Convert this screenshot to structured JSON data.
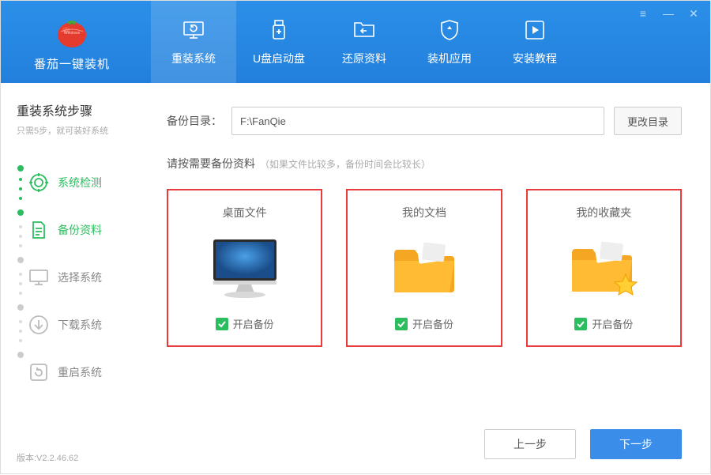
{
  "app": {
    "title": "番茄一键装机"
  },
  "nav": {
    "reinstall": "重装系统",
    "usb": "U盘启动盘",
    "restore": "还原资料",
    "apps": "装机应用",
    "tutorial": "安装教程"
  },
  "sidebar": {
    "title": "重装系统步骤",
    "subtitle": "只需5步，就可装好系统",
    "steps": {
      "s1": "系统检测",
      "s2": "备份资料",
      "s3": "选择系统",
      "s4": "下载系统",
      "s5": "重启系统"
    },
    "version_label": "版本:V2.2.46.62"
  },
  "main": {
    "dir_label": "备份目录：",
    "dir_value": "F:\\FanQie",
    "dir_button": "更改目录",
    "hint": "请按需要备份资料",
    "hint_note": "（如果文件比较多，备份时间会比较长）"
  },
  "cards": {
    "desktop": {
      "title": "桌面文件",
      "check": "开启备份"
    },
    "documents": {
      "title": "我的文档",
      "check": "开启备份"
    },
    "favorites": {
      "title": "我的收藏夹",
      "check": "开启备份"
    }
  },
  "buttons": {
    "prev": "上一步",
    "next": "下一步"
  }
}
